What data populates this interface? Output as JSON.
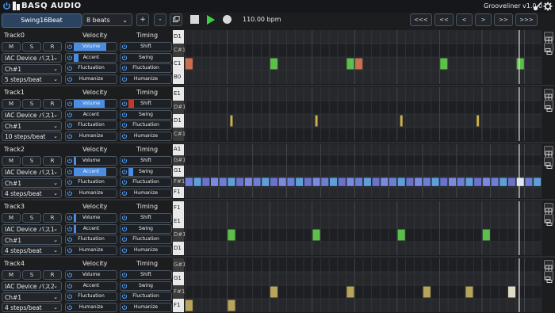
{
  "header": {
    "brand": "BASQ AUDIO",
    "version": "Grooveliner v1.0.0",
    "icons": [
      "power-icon",
      "logo-mark-icon",
      "guitar-icon",
      "gear-icon"
    ]
  },
  "transport": {
    "preset": "Swing16Beat",
    "beats": "8 beats",
    "plus": "+",
    "minus": "-",
    "bpm": "110.00 bpm",
    "nav": [
      "<<<",
      "<<",
      "<",
      ">",
      ">>",
      ">>>"
    ]
  },
  "colors": {
    "accent": "#4b8de0",
    "note_red": "#c8704e",
    "note_green": "#5cbf4a",
    "note_yellow": "#c8b04a",
    "note_blue": "#6c7fd6",
    "note_olive": "#b8a45a"
  },
  "tracks": [
    {
      "name": "Track0",
      "mute": "M",
      "solo": "S",
      "rec": "R",
      "device": "IAC Device バス1",
      "channel": "Ch#1",
      "steps": "5 steps/beat",
      "velocity_label": "Velocity",
      "timing_label": "Timing",
      "volume": "Volume",
      "accent": "Accent",
      "fluctuation": "Fluctuation",
      "humanize": "Humanize",
      "shift": "Shift",
      "swing": "Swing",
      "t_fluctuation": "Fluctuation",
      "t_humanize": "Humanize",
      "volume_level": 0.75,
      "accent_level": 0.1,
      "shift_level": 0,
      "swing_level": 0,
      "keys": [
        "D1",
        "C#1",
        "C1",
        "B0"
      ]
    },
    {
      "name": "Track1",
      "mute": "M",
      "solo": "S",
      "rec": "R",
      "device": "IAC Device バス1",
      "channel": "Ch#1",
      "steps": "10 steps/beat",
      "velocity_label": "Velocity",
      "timing_label": "Timing",
      "volume": "Volume",
      "accent": "Accent",
      "fluctuation": "Fluctuation",
      "humanize": "Humanize",
      "shift": "Shift",
      "swing": "Swing",
      "t_fluctuation": "Fluctuation",
      "t_humanize": "Humanize",
      "volume_level": 0.7,
      "accent_level": 0,
      "shift_level": 0.12,
      "swing_level": 0,
      "keys": [
        "E1",
        "D#1",
        "D1",
        "C#1"
      ]
    },
    {
      "name": "Track2",
      "mute": "M",
      "solo": "S",
      "rec": "R",
      "device": "IAC Device バス1",
      "channel": "Ch#1",
      "steps": "4 steps/beat",
      "velocity_label": "Velocity",
      "timing_label": "Timing",
      "volume": "Volume",
      "accent": "Accent",
      "fluctuation": "Fluctuation",
      "humanize": "Humanize",
      "shift": "Shift",
      "swing": "Swing",
      "t_fluctuation": "Fluctuation",
      "t_humanize": "Humanize",
      "volume_level": 0.05,
      "accent_level": 0.75,
      "shift_level": 0,
      "swing_level": 0.1,
      "keys": [
        "A1",
        "G#1",
        "G1",
        "F#1",
        "F1"
      ]
    },
    {
      "name": "Track3",
      "mute": "M",
      "solo": "S",
      "rec": "R",
      "device": "IAC Device バス1",
      "channel": "Ch#1",
      "steps": "4 steps/beat",
      "velocity_label": "Velocity",
      "timing_label": "Timing",
      "volume": "Volume",
      "accent": "Accent",
      "fluctuation": "Fluctuation",
      "humanize": "Humanize",
      "shift": "Shift",
      "swing": "Swing",
      "t_fluctuation": "Fluctuation",
      "t_humanize": "Humanize",
      "volume_level": 0.05,
      "accent_level": 0.05,
      "shift_level": 0,
      "swing_level": 0,
      "keys": [
        "F1",
        "E1",
        "D#1",
        "D1"
      ]
    },
    {
      "name": "Track4",
      "mute": "M",
      "solo": "S",
      "rec": "R",
      "device": "IAC Device バス2",
      "channel": "Ch#1",
      "steps": "4 steps/beat",
      "velocity_label": "Velocity",
      "timing_label": "Timing",
      "volume": "Volume",
      "accent": "Accent",
      "fluctuation": "Fluctuation",
      "humanize": "Humanize",
      "shift": "Shift",
      "swing": "Swing",
      "t_fluctuation": "Fluctuation",
      "t_humanize": "Humanize",
      "volume_level": 0,
      "accent_level": 0,
      "shift_level": 0,
      "swing_level": 0,
      "keys": [
        "G#1",
        "G1",
        "F#1",
        "F1"
      ]
    }
  ]
}
